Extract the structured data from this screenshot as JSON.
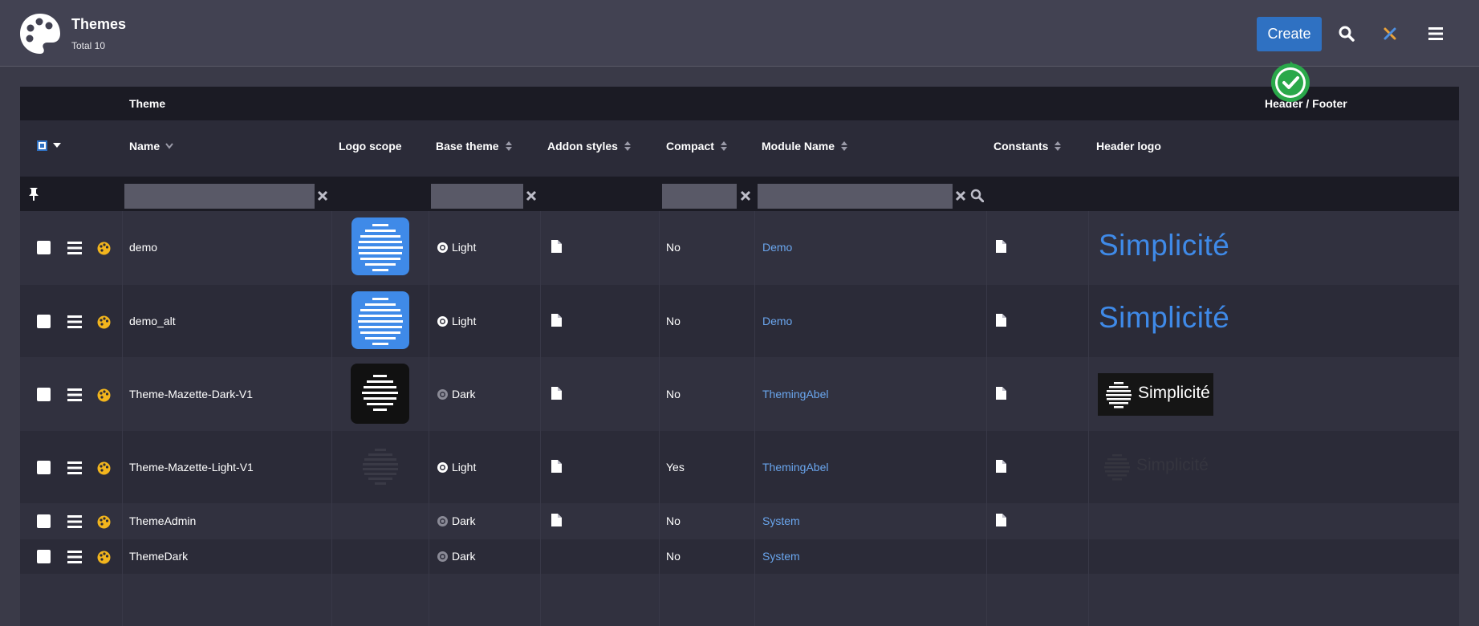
{
  "header": {
    "title": "Themes",
    "subtitle": "Total 10",
    "create_label": "Create"
  },
  "grid": {
    "group_theme": "Theme",
    "group_header_footer": "Header / Footer",
    "columns": {
      "name": "Name",
      "logo_scope": "Logo scope",
      "base_theme": "Base theme",
      "addon_styles": "Addon styles",
      "compact": "Compact",
      "module_name": "Module Name",
      "constants": "Constants",
      "header_logo": "Header logo"
    },
    "rows": [
      {
        "name": "demo",
        "base_theme": "Light",
        "compact": "No",
        "module": "Demo",
        "header_logo_text": "Simplicité"
      },
      {
        "name": "demo_alt",
        "base_theme": "Light",
        "compact": "No",
        "module": "Demo",
        "header_logo_text": "Simplicité"
      },
      {
        "name": "Theme-Mazette-Dark-V1",
        "base_theme": "Dark",
        "compact": "No",
        "module": "ThemingAbel",
        "header_logo_text": "Simplicité"
      },
      {
        "name": "Theme-Mazette-Light-V1",
        "base_theme": "Light",
        "compact": "Yes",
        "module": "ThemingAbel",
        "header_logo_text": "Simplicité"
      },
      {
        "name": "ThemeAdmin",
        "base_theme": "Dark",
        "compact": "No",
        "module": "System"
      },
      {
        "name": "ThemeDark",
        "base_theme": "Dark",
        "compact": "No",
        "module": "System"
      }
    ]
  },
  "colors": {
    "accent": "#2f71c2",
    "link": "#6aa6ee",
    "brand_blue": "#3f8ae8",
    "success": "#2aa84a"
  }
}
